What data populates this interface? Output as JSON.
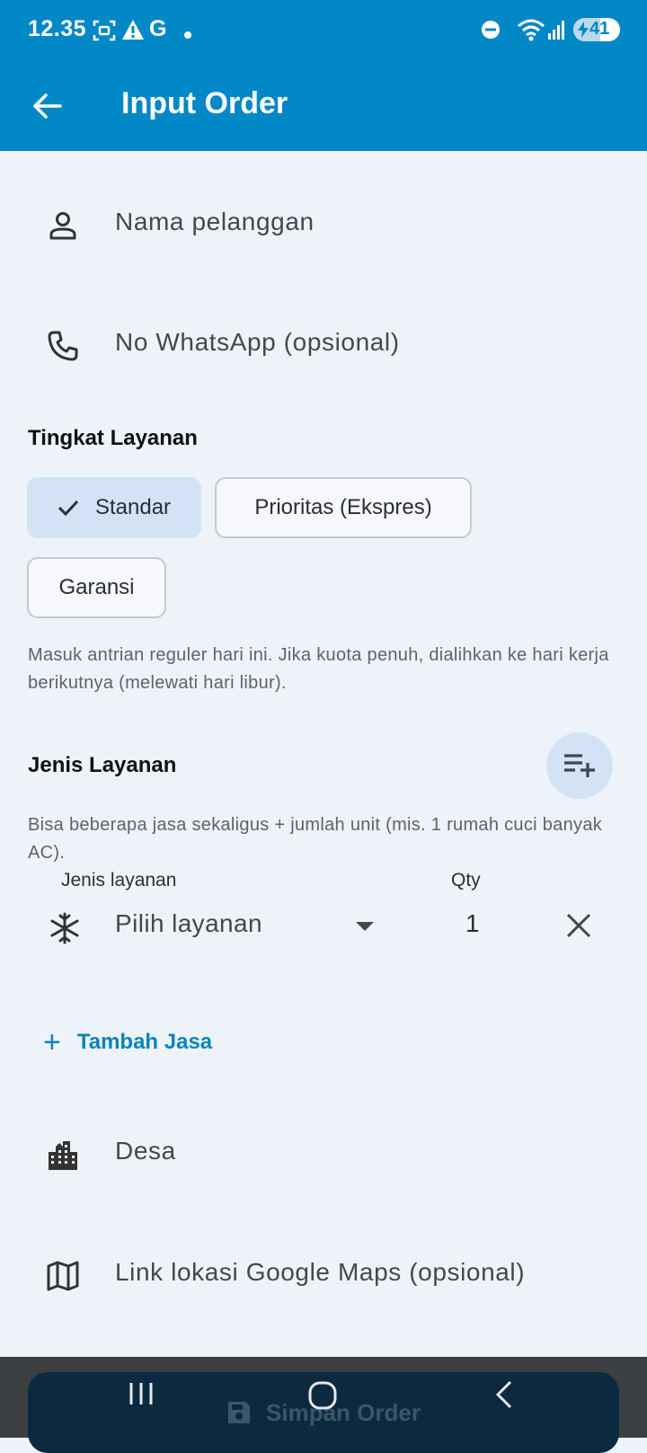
{
  "status_bar": {
    "time": "12.35",
    "battery": "41",
    "letter": "G",
    "icons": [
      "screenshot-icon",
      "warning-icon",
      "dot-icon",
      "dnd-icon",
      "wifi-icon",
      "signal-icon",
      "battery-icon"
    ]
  },
  "app_bar": {
    "title": "Input Order",
    "back_icon": "arrow-left-icon"
  },
  "form": {
    "name_field": {
      "placeholder": "Nama pelanggan",
      "icon": "person-icon"
    },
    "whatsapp_field": {
      "placeholder": "No WhatsApp (opsional)",
      "icon": "phone-icon"
    },
    "service_level": {
      "title": "Tingkat Layanan",
      "options": [
        {
          "label": "Standar",
          "selected": true
        },
        {
          "label": "Prioritas (Ekspres)",
          "selected": false
        },
        {
          "label": "Garansi",
          "selected": false
        }
      ],
      "helper": "Masuk antrian reguler hari ini. Jika kuota penuh, dialihkan ke hari kerja berikutnya (melewati hari libur)."
    },
    "service_type": {
      "title": "Jenis Layanan",
      "helper": "Bisa beberapa jasa sekaligus + jumlah unit (mis. 1 rumah cuci banyak AC).",
      "column_label": "Jenis layanan",
      "qty_label": "Qty",
      "rows": [
        {
          "select_value": "Pilih layanan",
          "qty": "1",
          "icon": "snowflake-icon"
        }
      ],
      "add_label": "Tambah Jasa"
    },
    "village_field": {
      "placeholder": "Desa",
      "icon": "city-icon"
    },
    "maps_field": {
      "placeholder": "Link lokasi Google Maps (opsional)",
      "icon": "map-icon"
    }
  },
  "save_button": {
    "label": "Simpan Order",
    "icon": "save-icon"
  },
  "nav_bar": {
    "icons": [
      "recents-icon",
      "home-icon",
      "back-icon"
    ]
  },
  "colors": {
    "primary": "#0288c7",
    "background": "#eef3fa",
    "chip_selected": "#d3e3f5",
    "accent_text": "#0a83bd"
  }
}
